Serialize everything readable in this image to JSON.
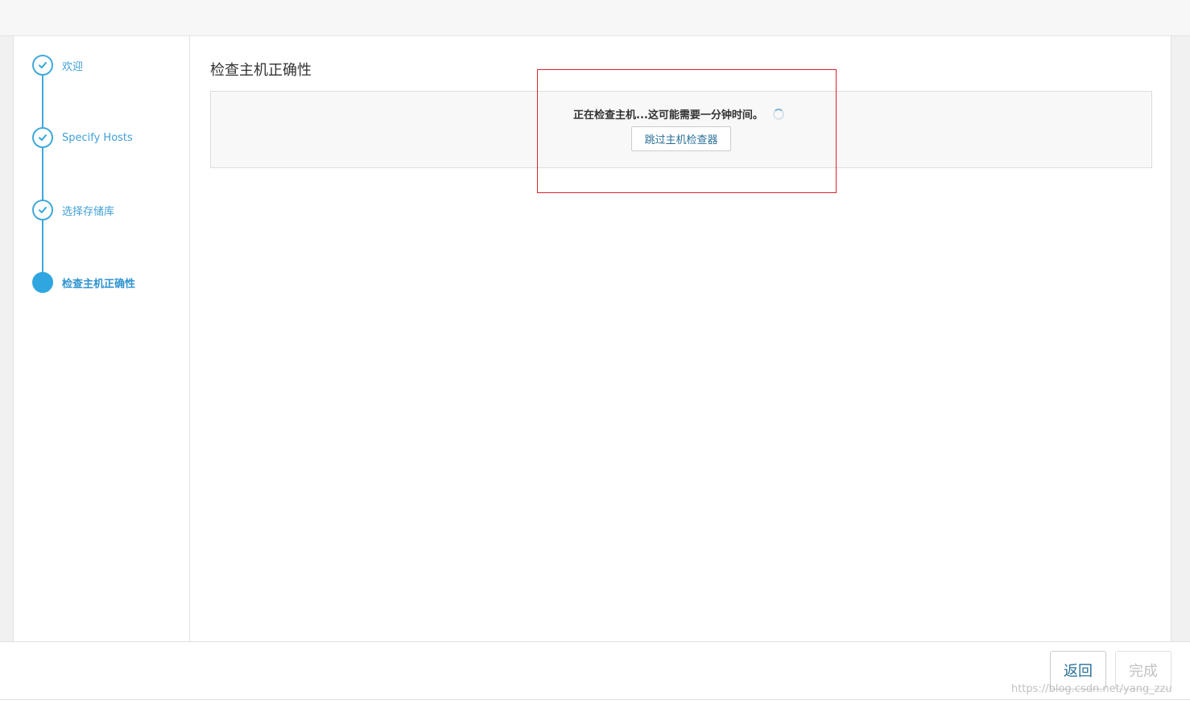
{
  "wizard": {
    "steps": [
      {
        "label": "欢迎",
        "state": "completed"
      },
      {
        "label": "Specify Hosts",
        "state": "completed"
      },
      {
        "label": "选择存储库",
        "state": "completed"
      },
      {
        "label": "检查主机正确性",
        "state": "active"
      }
    ]
  },
  "content": {
    "title": "检查主机正确性",
    "checking_text": "正在检查主机...这可能需要一分钟时间。",
    "skip_button_label": "跳过主机检查器"
  },
  "footer": {
    "back_label": "返回",
    "finish_label": "完成"
  },
  "watermark": "https://blog.csdn.net/yang_zzu",
  "colors": {
    "accent": "#2fa6df",
    "step_label": "#3fa0d6",
    "highlight_border": "#d9232e",
    "button_text": "#2a6f97",
    "disabled_text": "#c2c2c2"
  }
}
